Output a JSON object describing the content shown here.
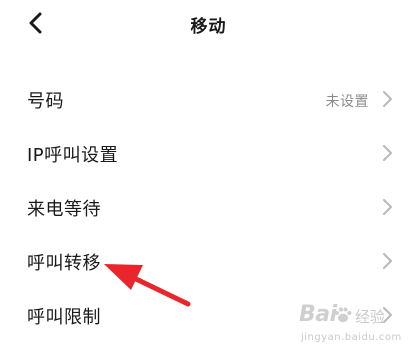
{
  "header": {
    "title": "移动",
    "back_icon": "chevron-left-icon"
  },
  "rows": [
    {
      "label": "号码",
      "value": "未设置",
      "icon": "chevron-right-icon"
    },
    {
      "label": "IP呼叫设置",
      "value": "",
      "icon": "chevron-right-icon"
    },
    {
      "label": "来电等待",
      "value": "",
      "icon": "chevron-right-icon"
    },
    {
      "label": "呼叫转移",
      "value": "",
      "icon": "chevron-right-icon"
    },
    {
      "label": "呼叫限制",
      "value": "",
      "icon": "chevron-right-icon"
    }
  ],
  "annotation": {
    "icon": "red-arrow-pointer-icon",
    "color": "#e8262c",
    "target_row": "呼叫转移"
  },
  "watermark": {
    "brand": "Bai",
    "sub": "经验",
    "url": "jingyan.baidu.com"
  },
  "colors": {
    "text": "#1a1a1a",
    "secondary": "#8c8c8c",
    "chevron": "#b8b8b8"
  }
}
